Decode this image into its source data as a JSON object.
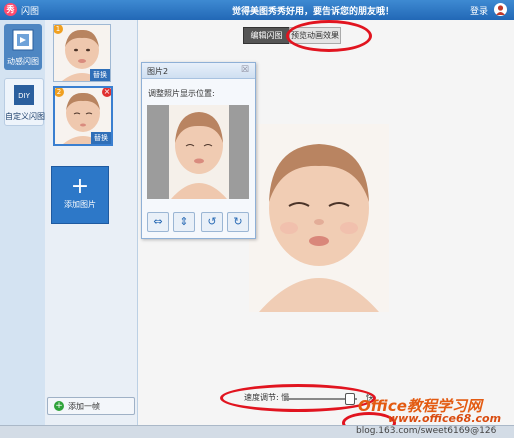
{
  "titlebar": {
    "logo_glyph": "秀",
    "app_title": "闪图",
    "promo": "觉得美图秀秀好用，要告诉您的朋友哦！",
    "login": "登录"
  },
  "modes": [
    {
      "label": "动感闪图"
    },
    {
      "label": "自定义闪图",
      "icon_text": "DIY"
    }
  ],
  "thumbnails": [
    {
      "index": "1",
      "replace_label": "替换"
    },
    {
      "index": "2",
      "replace_label": "替换",
      "delete_glyph": "×"
    }
  ],
  "add_picture": {
    "plus": "+",
    "label": "添加图片"
  },
  "add_frame": {
    "plus": "+",
    "label": "添加一帧"
  },
  "tabs": {
    "edit": "编辑闪图",
    "preview": "预览动画效果"
  },
  "dialog": {
    "title": "图片2",
    "close": "☒",
    "hint": "调整照片显示位置:"
  },
  "speed": {
    "label": "速度调节: 慢",
    "fast": "快",
    "level": 0.9
  },
  "watermark": {
    "line1": "Office教程学习网",
    "line2": "www.office68.com",
    "line3": "blog.163.com/sweet6169@126"
  },
  "colors": {
    "titlebar": "#2268b6",
    "highlight_circle": "#e1141f",
    "accent": "#2d78c8"
  }
}
